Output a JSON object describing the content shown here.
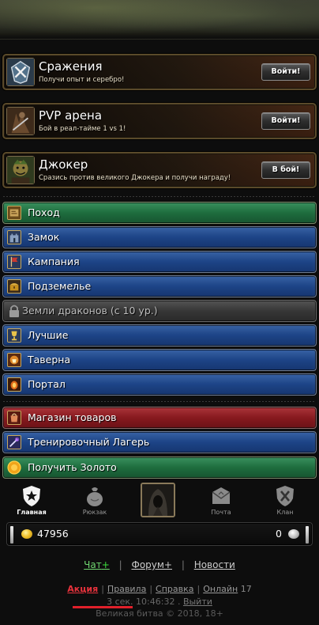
{
  "banners": [
    {
      "title": "Сражения",
      "subtitle": "Получи опыт и серебро!",
      "button": "Войти!",
      "icon": "crossed-swords-emblem-icon"
    },
    {
      "title": "PVP арена",
      "subtitle": "Бой в реал-тайме 1 vs 1!",
      "button": "Войти!",
      "icon": "arena-warrior-icon"
    },
    {
      "title": "Джокер",
      "subtitle": "Сразись против великого Джокера и получи награду!",
      "button": "В бой!",
      "icon": "joker-portrait-icon"
    }
  ],
  "menu": [
    {
      "label": "Поход",
      "color": "#1d6a3c",
      "icon": "map-scroll-icon"
    },
    {
      "label": "Замок",
      "color": "#1c4284",
      "icon": "castle-icon"
    },
    {
      "label": "Кампания",
      "color": "#1c4284",
      "icon": "campaign-banner-icon"
    },
    {
      "label": "Подземелье",
      "color": "#1c4284",
      "icon": "treasure-chest-icon"
    },
    {
      "label": "Земли драконов (с 10 ур.)",
      "color": "#353535",
      "icon": "lock-icon"
    },
    {
      "label": "Лучшие",
      "color": "#1c4284",
      "icon": "trophy-icon"
    },
    {
      "label": "Таверна",
      "color": "#1c4284",
      "icon": "tavern-icon"
    },
    {
      "label": "Портал",
      "color": "#1c4284",
      "icon": "portal-icon"
    },
    {
      "label": "Магазин товаров",
      "color": "#84181d",
      "icon": "shop-icon"
    },
    {
      "label": "Тренировочный Лагерь",
      "color": "#1c4284",
      "icon": "training-sword-icon"
    },
    {
      "label": "Получить Золото",
      "color": "#1d6a3c",
      "icon": "gold-coin-icon"
    }
  ],
  "tabs": [
    {
      "label": "Главная",
      "icon": "home-shield-star-icon",
      "active": true
    },
    {
      "label": "Рюкзак",
      "icon": "backpack-bag-icon",
      "active": false
    },
    {
      "label": "",
      "icon": "hero-avatar",
      "active": false
    },
    {
      "label": "Почта",
      "icon": "mail-envelope-icon",
      "active": false
    },
    {
      "label": "Клан",
      "icon": "clan-crossed-swords-icon",
      "active": false
    }
  ],
  "resources": {
    "gold": "47956",
    "silver": "0"
  },
  "links": {
    "chat": "Чат",
    "chat_plus": "+",
    "forum": "Форум+",
    "news": "Новости"
  },
  "footer": {
    "promo": "Акция",
    "rules": "Правила",
    "help": "Справка",
    "online_label": "Онлайн",
    "online_count": "17",
    "timing": "3 сек.",
    "time": "10:46:32",
    "logout": "Выйти",
    "copyright": "Великая битва © 2018, 18+"
  }
}
